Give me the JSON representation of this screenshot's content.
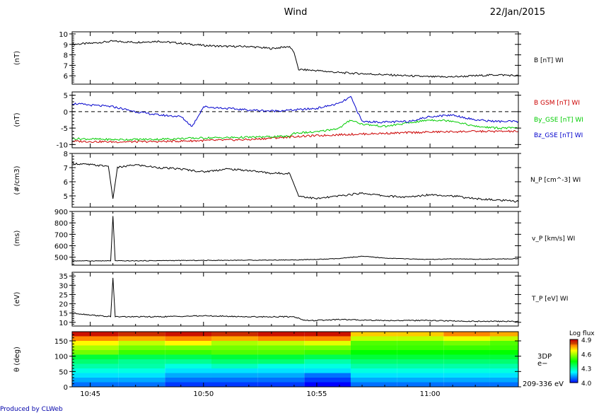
{
  "header": {
    "mission": "Wind",
    "date": "22/Jan/2015"
  },
  "footer": {
    "produced_by": "Produced by CLWeb"
  },
  "x_axis": {
    "range_min": [
      44.2,
      63.9
    ],
    "tick_labels": [
      "10:45",
      "10:50",
      "10:55",
      "11:00"
    ],
    "tick_minutes": [
      45,
      50,
      55,
      60
    ]
  },
  "chart_data": [
    {
      "type": "line",
      "panel": "B",
      "ylabel": "(nT)",
      "ylim": [
        5.2,
        10.2
      ],
      "yticks": [
        6,
        7,
        8,
        9,
        10
      ],
      "series": [
        {
          "name": "B [nT] WI",
          "color": "#000000",
          "x": [
            44.2,
            45.0,
            46.0,
            47.0,
            48.0,
            49.0,
            50.0,
            51.0,
            52.0,
            53.0,
            53.8,
            54.0,
            54.2,
            55.0,
            56.0,
            57.0,
            58.0,
            59.0,
            60.0,
            61.0,
            62.0,
            63.0,
            63.9
          ],
          "y": [
            9.0,
            9.1,
            9.3,
            9.2,
            9.3,
            9.1,
            8.9,
            8.8,
            8.8,
            8.6,
            8.8,
            8.2,
            6.6,
            6.5,
            6.3,
            6.2,
            6.1,
            6.0,
            5.9,
            5.9,
            6.0,
            6.1,
            6.0
          ]
        }
      ]
    },
    {
      "type": "line",
      "panel": "B_GSE",
      "ylabel": "(nT)",
      "ylim": [
        -11,
        6
      ],
      "yticks": [
        -10,
        -5,
        0,
        5
      ],
      "zero_line": "dashed",
      "series": [
        {
          "name": "B GSM [nT] WI",
          "color": "#cc0000",
          "x": [
            44.2,
            46.0,
            48.0,
            50.0,
            52.0,
            54.0,
            56.0,
            58.0,
            60.0,
            62.0,
            63.9
          ],
          "y": [
            -9.0,
            -9.2,
            -9.1,
            -8.8,
            -8.5,
            -7.6,
            -7.0,
            -6.6,
            -6.2,
            -6.0,
            -6.0
          ]
        },
        {
          "name": "By_GSE [nT] WI",
          "color": "#00cc00",
          "x": [
            44.2,
            46.0,
            48.0,
            50.0,
            52.0,
            53.8,
            54.0,
            55.0,
            56.0,
            56.5,
            57.0,
            58.0,
            59.0,
            60.0,
            61.0,
            62.0,
            63.0,
            63.9
          ],
          "y": [
            -8.2,
            -8.5,
            -8.4,
            -8.0,
            -7.8,
            -7.5,
            -6.5,
            -6.2,
            -5.0,
            -2.5,
            -3.8,
            -4.5,
            -3.5,
            -2.5,
            -2.8,
            -4.5,
            -5.0,
            -5.0
          ]
        },
        {
          "name": "Bz_GSE [nT] WI",
          "color": "#0000cc",
          "x": [
            44.2,
            45.0,
            46.0,
            47.0,
            48.0,
            49.0,
            49.5,
            50.0,
            51.0,
            52.0,
            53.0,
            54.0,
            55.0,
            56.0,
            56.5,
            57.0,
            58.0,
            59.0,
            60.0,
            61.0,
            62.0,
            63.0,
            63.9
          ],
          "y": [
            2.5,
            2.0,
            1.5,
            0.0,
            -1.0,
            -1.5,
            -4.5,
            1.5,
            1.0,
            0.5,
            0.2,
            0.5,
            1.0,
            2.5,
            4.5,
            -3.0,
            -3.2,
            -3.0,
            -1.5,
            -1.0,
            -2.5,
            -3.0,
            -3.0
          ]
        }
      ]
    },
    {
      "type": "line",
      "panel": "N_P",
      "ylabel": "(#/cm3)",
      "ylim": [
        4.2,
        8.0
      ],
      "yticks": [
        5,
        6,
        7,
        8
      ],
      "series": [
        {
          "name": "N_P [cm^-3] WI",
          "color": "#000000",
          "x": [
            44.2,
            45.0,
            45.8,
            46.0,
            46.2,
            47.0,
            48.0,
            49.0,
            50.0,
            51.0,
            52.0,
            53.0,
            53.8,
            54.2,
            55.0,
            56.0,
            57.0,
            58.0,
            59.0,
            60.0,
            61.0,
            62.0,
            63.0,
            63.9
          ],
          "y": [
            7.3,
            7.2,
            7.1,
            4.8,
            7.0,
            7.2,
            7.0,
            6.9,
            6.7,
            6.9,
            6.8,
            6.6,
            6.6,
            5.0,
            4.8,
            5.0,
            5.2,
            5.0,
            4.9,
            5.1,
            5.0,
            4.8,
            4.7,
            4.6
          ]
        }
      ]
    },
    {
      "type": "line",
      "panel": "V_P",
      "ylabel": "(ms)",
      "ylim": [
        430,
        900
      ],
      "yticks": [
        500,
        600,
        700,
        800,
        900
      ],
      "series": [
        {
          "name": "v_P [km/s] WI",
          "color": "#000000",
          "x": [
            44.2,
            45.5,
            45.9,
            46.0,
            46.1,
            47.0,
            48.0,
            50.0,
            52.0,
            54.0,
            55.0,
            56.0,
            57.0,
            58.0,
            59.0,
            60.0,
            61.0,
            62.0,
            63.0,
            63.9
          ],
          "y": [
            468,
            468,
            468,
            860,
            468,
            468,
            470,
            472,
            474,
            476,
            480,
            488,
            508,
            492,
            485,
            480,
            485,
            482,
            484,
            488
          ]
        }
      ]
    },
    {
      "type": "line",
      "panel": "T_P",
      "ylabel": "(eV)",
      "ylim": [
        8,
        37
      ],
      "yticks": [
        10,
        15,
        20,
        25,
        30,
        35
      ],
      "series": [
        {
          "name": "T_P [eV] WI",
          "color": "#000000",
          "x": [
            44.2,
            45.0,
            45.9,
            46.0,
            46.1,
            47.0,
            48.0,
            50.0,
            52.0,
            54.0,
            54.5,
            55.0,
            56.0,
            58.0,
            60.0,
            62.0,
            63.9
          ],
          "y": [
            15,
            14,
            13,
            34,
            13,
            13,
            13,
            13.5,
            13,
            13,
            11,
            11,
            11.5,
            11,
            11,
            10.5,
            10.5
          ]
        }
      ]
    },
    {
      "type": "heatmap",
      "panel": "PAD",
      "ylabel": "θ (deg)",
      "ylim": [
        0,
        180
      ],
      "yticks": [
        0,
        50,
        100,
        150
      ],
      "right_label": [
        "3DP",
        "e−",
        "209-336 eV"
      ],
      "colorbar": {
        "label": "Log flux",
        "range": [
          4.0,
          4.9
        ],
        "ticks": [
          "4.9",
          "4.6",
          "4.3",
          "4.0"
        ]
      },
      "time_bins": [
        44.2,
        46.25,
        48.3,
        50.35,
        52.4,
        54.45,
        56.5,
        58.55,
        60.6,
        62.65,
        63.9
      ],
      "angle_bins": [
        0,
        15,
        30,
        45,
        60,
        75,
        90,
        105,
        120,
        135,
        150,
        165,
        180
      ],
      "values": [
        [
          4.1,
          4.1,
          4.05,
          4.05,
          4.05,
          4.0,
          4.1,
          4.1,
          4.1,
          4.1
        ],
        [
          4.15,
          4.15,
          4.1,
          4.1,
          4.1,
          4.05,
          4.15,
          4.15,
          4.15,
          4.15
        ],
        [
          4.2,
          4.2,
          4.15,
          4.15,
          4.15,
          4.1,
          4.2,
          4.2,
          4.2,
          4.2
        ],
        [
          4.25,
          4.25,
          4.2,
          4.2,
          4.2,
          4.2,
          4.25,
          4.25,
          4.25,
          4.25
        ],
        [
          4.3,
          4.3,
          4.25,
          4.28,
          4.25,
          4.25,
          4.3,
          4.3,
          4.3,
          4.3
        ],
        [
          4.35,
          4.32,
          4.32,
          4.35,
          4.35,
          4.3,
          4.35,
          4.35,
          4.35,
          4.35
        ],
        [
          4.4,
          4.38,
          4.38,
          4.4,
          4.4,
          4.38,
          4.4,
          4.4,
          4.4,
          4.4
        ],
        [
          4.55,
          4.5,
          4.5,
          4.52,
          4.52,
          4.5,
          4.45,
          4.45,
          4.45,
          4.45
        ],
        [
          4.6,
          4.55,
          4.55,
          4.55,
          4.55,
          4.55,
          4.5,
          4.5,
          4.5,
          4.5
        ],
        [
          4.68,
          4.62,
          4.68,
          4.6,
          4.62,
          4.65,
          4.52,
          4.52,
          4.55,
          4.52
        ],
        [
          4.78,
          4.75,
          4.78,
          4.75,
          4.78,
          4.78,
          4.62,
          4.62,
          4.66,
          4.62
        ],
        [
          4.88,
          4.85,
          4.88,
          4.85,
          4.88,
          4.88,
          4.72,
          4.72,
          4.78,
          4.75
        ]
      ]
    }
  ]
}
